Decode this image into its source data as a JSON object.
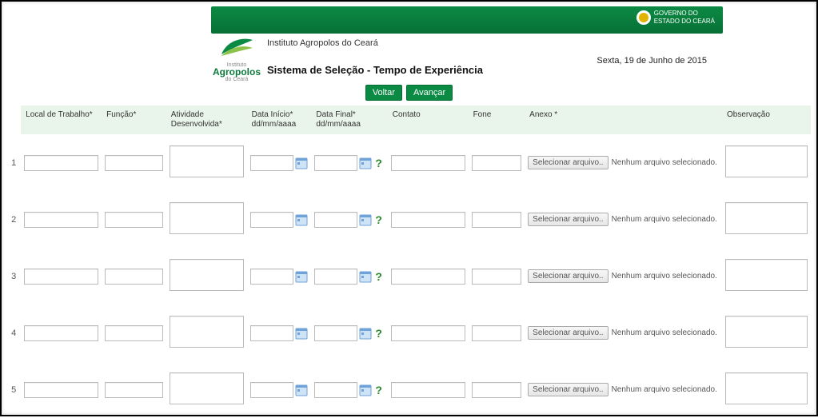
{
  "header": {
    "gov_line1": "GOVERNO DO",
    "gov_line2": "ESTADO DO CEARÁ",
    "institute": "Instituto Agropolos do Ceará",
    "logo_small_top": "Instituto",
    "logo_main": "Agropolos",
    "logo_small_bottom": "do Ceará",
    "page_title": "Sistema de Seleção - Tempo de Experiência",
    "date": "Sexta, 19 de Junho de 2015"
  },
  "buttons": {
    "voltar": "Voltar",
    "avancar": "Avançar"
  },
  "columns": {
    "local": "Local de Trabalho*",
    "funcao": "Função*",
    "atividade": "Atividade Desenvolvida*",
    "data_inicio_l1": "Data Início*",
    "data_inicio_l2": "dd/mm/aaaa",
    "data_final_l1": "Data Final*",
    "data_final_l2": "dd/mm/aaaa",
    "contato": "Contato",
    "fone": "Fone",
    "anexo": "Anexo *",
    "observacao": "Observação"
  },
  "file": {
    "button": "Selecionar arquivo..",
    "status": "Nenhum arquivo selecionado."
  },
  "help": "?",
  "rows": [
    "1",
    "2",
    "3",
    "4",
    "5"
  ]
}
